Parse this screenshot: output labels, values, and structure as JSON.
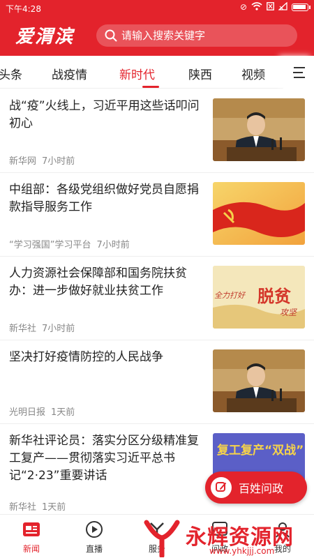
{
  "status_bar": {
    "time": "下午4:28"
  },
  "header": {
    "logo_text": "爱渭滨",
    "search_placeholder": "请输入搜索关键字"
  },
  "tabs": [
    {
      "label": "头条"
    },
    {
      "label": "战疫情"
    },
    {
      "label": "新时代",
      "active": true
    },
    {
      "label": "陕西"
    },
    {
      "label": "视频"
    }
  ],
  "news": [
    {
      "title": "战“疫”火线上，习近平用这些话叩问初心",
      "source": "新华网",
      "time": "7小时前",
      "thumb": "meeting-photo"
    },
    {
      "title": "中组部：各级党组织做好党员自愿捐款指导服务工作",
      "source": "“学习强国”学习平台",
      "time": "7小时前",
      "thumb": "party-flag"
    },
    {
      "title": "人力资源社会保障部和国务院扶贫办：进一步做好就业扶贫工作",
      "source": "新华社",
      "time": "7小时前",
      "thumb": "poverty-banner",
      "thumb_text_1": "全力打好",
      "thumb_text_2": "脱贫",
      "thumb_text_3": "攻坚"
    },
    {
      "title": "坚决打好疫情防控的人民战争",
      "source": "光明日报",
      "time": "1天前",
      "thumb": "meeting-photo"
    },
    {
      "title": "新华社评论员：落实分区分级精准复工复产——贯彻落实习近平总书记“2·23”重要讲话",
      "source": "新华社",
      "time": "1天前",
      "thumb": "resume-work-banner",
      "thumb_text": "复工复产“双战”"
    }
  ],
  "fab": {
    "label": "百姓问政"
  },
  "bottom_nav": [
    {
      "label": "新闻",
      "icon": "news-icon",
      "active": true
    },
    {
      "label": "直播",
      "icon": "play-icon"
    },
    {
      "label": "服务",
      "icon": "service-icon"
    },
    {
      "label": "问政",
      "icon": "ask-icon"
    },
    {
      "label": "我的",
      "icon": "user-icon"
    }
  ],
  "watermark": {
    "text": "永辉资源网",
    "url": "www.yhkjjj.com"
  },
  "colors": {
    "brand_red": "#e3232c",
    "text": "#222222",
    "meta": "#888888"
  }
}
